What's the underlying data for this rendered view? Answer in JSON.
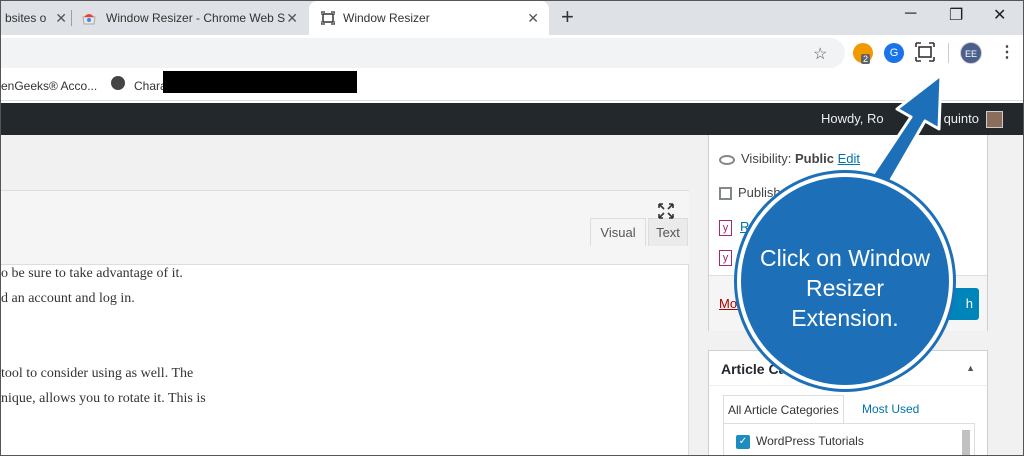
{
  "browser": {
    "tabs": [
      {
        "title": "bsites o"
      },
      {
        "title": "Window Resizer - Chrome Web S"
      },
      {
        "title": "Window Resizer"
      }
    ],
    "new_tab": "+",
    "controls": {
      "minimize": "─",
      "restore": "❐",
      "close": "✕"
    },
    "extensions": {
      "badge": "2",
      "g_letter": "G"
    },
    "profile_initials": "EE"
  },
  "bookmarks": [
    {
      "label": "enGeeks® Acco..."
    },
    {
      "label": "Chara"
    }
  ],
  "adminbar": {
    "howdy": "Howdy, Ro"
  },
  "editor": {
    "tab_visual": "Visual",
    "tab_text": "Text",
    "lines": [
      "o be sure to take advantage of it.",
      "d an account and log in.",
      "",
      "",
      "tool to consider using as well. The",
      "nique, allows you to rotate it. This is"
    ]
  },
  "publish": {
    "visibility_label": "Visibility: ",
    "visibility_value": "Public",
    "visibility_edit": "Edit",
    "publish_label": "Publish",
    "readability": "Re",
    "move": "Mov",
    "publish_button": "h"
  },
  "categories": {
    "title": "Article Cate",
    "tab_all": "All Article Categories",
    "tab_used": "Most Used",
    "item": "WordPress Tutorials"
  },
  "callout": {
    "lines": [
      "Click on Window",
      "Resizer",
      "Extension."
    ],
    "color": "#1d70b8"
  },
  "user_name_tail": "quinto"
}
